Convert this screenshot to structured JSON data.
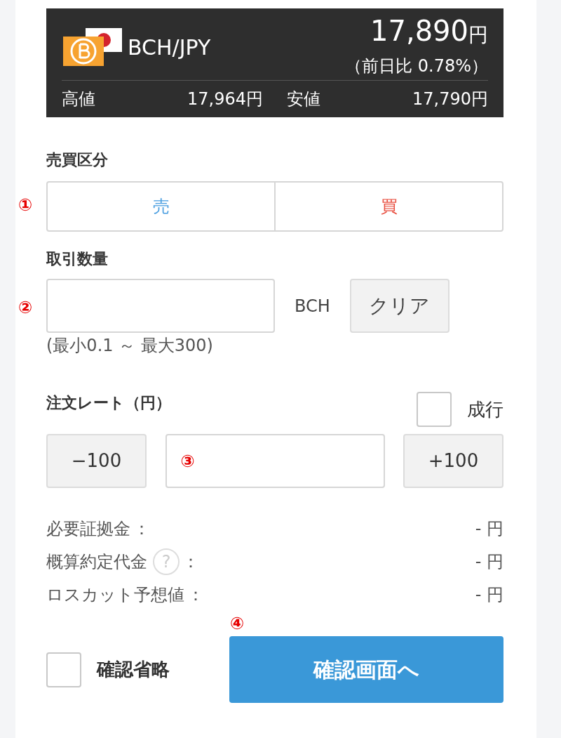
{
  "ticker": {
    "pair": "BCH/JPY",
    "price": "17,890",
    "price_unit": "円",
    "change": "（前日比 0.78%）",
    "high_label": "高値",
    "high": "17,964円",
    "low_label": "安値",
    "low": "17,790円"
  },
  "side": {
    "label": "売買区分",
    "marker": "①",
    "options": [
      {
        "label": "売",
        "selected": false,
        "color": "#4a9ee0"
      },
      {
        "label": "買",
        "selected": false,
        "color": "#e84c3d"
      }
    ]
  },
  "quantity": {
    "label": "取引数量",
    "marker": "②",
    "unit": "BCH",
    "clear_button": "クリア",
    "hint": "(最小0.1 ～ 最大300)"
  },
  "rate": {
    "label": "注文レート（円）",
    "market": {
      "label": "成行",
      "checked": false
    },
    "minus_button": "−100",
    "plus_button": "+100",
    "marker": "③"
  },
  "summary": [
    {
      "label": "必要証拠金",
      "suffix": "：",
      "value": "- 円"
    },
    {
      "label": "概算約定代金",
      "help_icon": "?",
      "suffix": "：",
      "value": "- 円"
    },
    {
      "label": "ロスカット予想値",
      "suffix": "：",
      "value": "- 円"
    }
  ],
  "footer": {
    "skip_confirm": {
      "label": "確認省略",
      "checked": false
    },
    "marker": "④",
    "submit": "確認画面へ"
  }
}
